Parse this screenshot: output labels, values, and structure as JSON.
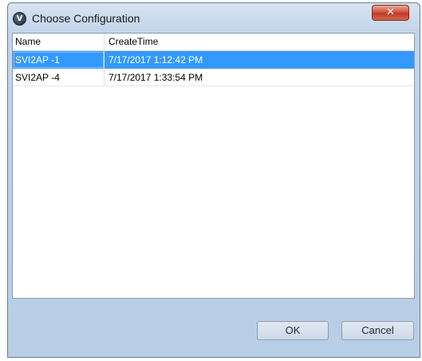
{
  "window": {
    "title": "Choose Configuration",
    "icon": "v-logo-icon",
    "icon_glyph": "V",
    "close_glyph": "✕"
  },
  "table": {
    "columns": [
      "Name",
      "CreateTime"
    ],
    "rows": [
      {
        "name": "SVI2AP -1",
        "create_time": "7/17/2017 1:12:42 PM",
        "selected": true
      },
      {
        "name": "SVI2AP -4",
        "create_time": "7/17/2017 1:33:54 PM",
        "selected": false
      }
    ]
  },
  "buttons": {
    "ok_label": "OK",
    "cancel_label": "Cancel"
  },
  "colors": {
    "selection": "#3399ff",
    "close_button": "#c13a26"
  }
}
